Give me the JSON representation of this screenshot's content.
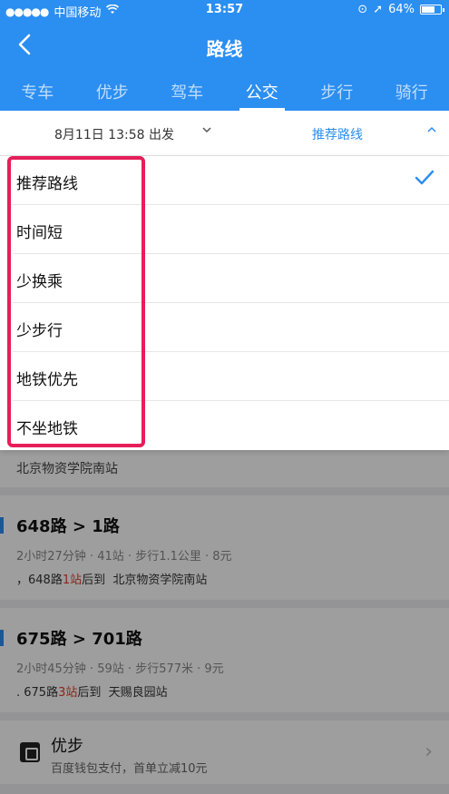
{
  "status": {
    "signal_dots": "●●●●●",
    "carrier": "中国移动",
    "wifi": "wifi-icon",
    "time": "13:57",
    "battery_pct": "64%"
  },
  "header": {
    "title": "路线",
    "back_icon": "back-arrow-icon",
    "tabs": [
      "专车",
      "优步",
      "驾车",
      "公交",
      "步行",
      "骑行"
    ],
    "active_tab": "公交"
  },
  "options": {
    "depart": "8月11日 13:58 出发",
    "sort": "推荐路线"
  },
  "dropdown": {
    "items": [
      "推荐路线",
      "时间短",
      "少换乘",
      "少步行",
      "地铁优先",
      "不坐地铁"
    ],
    "selected": "推荐路线"
  },
  "routes": [
    {
      "station": "北京物资学院南站"
    },
    {
      "name_a": "648路",
      "name_b": "1路",
      "duration": "2小时27分钟",
      "stops": "41站",
      "walk": "步行1.1公里",
      "price": "8元",
      "line": "648路",
      "line_stops": "1站",
      "after": "后到",
      "station": "北京物资学院南站"
    },
    {
      "name_a": "675路",
      "name_b": "701路",
      "duration": "2小时45分钟",
      "stops": "59站",
      "walk": "步行577米",
      "price": "9元",
      "line": "675路",
      "line_stops": "3站",
      "after": "后到",
      "station": "天赐良园站"
    }
  ],
  "promo": {
    "title": "优步",
    "subtitle": "百度钱包支付，首单立减10元"
  },
  "colors": {
    "brand": "#2b8ef1",
    "highlight": "#e61e5a",
    "red": "#e23a2e"
  }
}
